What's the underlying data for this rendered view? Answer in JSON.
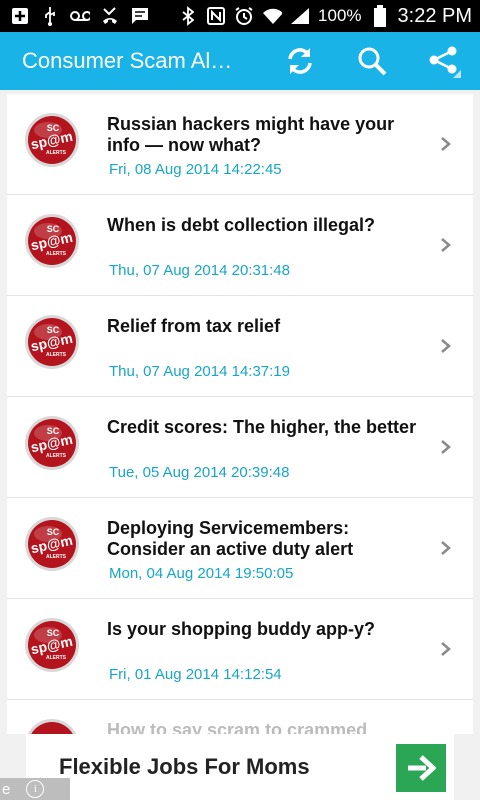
{
  "status_bar": {
    "icons": [
      "add-box-icon",
      "usb-icon",
      "voicemail-icon",
      "missed-call-icon",
      "message-icon",
      "bluetooth-icon",
      "nfc-icon",
      "alarm-icon",
      "wifi-icon",
      "signal-icon",
      "battery-icon"
    ],
    "battery_percent": "100%",
    "time": "3:22 PM"
  },
  "app_bar": {
    "title": "Consumer Scam Al…",
    "actions": [
      "refresh-icon",
      "search-icon",
      "share-icon"
    ]
  },
  "logo_text": {
    "top": "SC",
    "mid": "sp@m",
    "bottom": "ALERTS"
  },
  "items": [
    {
      "title": "Russian hackers might have your info — now what?",
      "date": "Fri, 08 Aug 2014 14:22:45"
    },
    {
      "title": "When is debt collection illegal?",
      "date": "Thu, 07 Aug 2014 20:31:48"
    },
    {
      "title": "Relief from tax relief",
      "date": "Thu, 07 Aug 2014 14:37:19"
    },
    {
      "title": "Credit scores: The higher, the better",
      "date": "Tue, 05 Aug 2014 20:39:48"
    },
    {
      "title": "Deploying Servicemembers: Consider an active duty alert",
      "date": "Mon, 04 Aug 2014 19:50:05"
    },
    {
      "title": "Is your shopping buddy app-y?",
      "date": "Fri, 01 Aug 2014 14:12:54"
    },
    {
      "title": "How to say scram to crammed",
      "date": ""
    }
  ],
  "ad": {
    "text": "Flexible Jobs For Moms",
    "corner_text": "e",
    "info_label": "i",
    "button_color": "#2aa655"
  },
  "colors": {
    "app_bar": "#1ab3e8",
    "date": "#17a6c6",
    "logo": "#b3141d"
  }
}
